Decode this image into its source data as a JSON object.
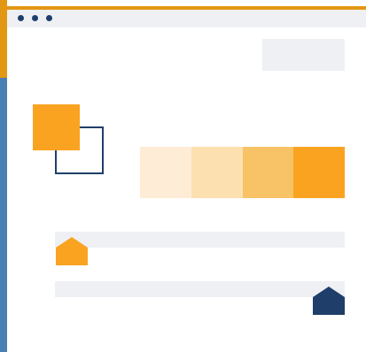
{
  "window": {
    "titlebar": {
      "controls": [
        {
          "name": "window-dot-1"
        },
        {
          "name": "window-dot-2"
        },
        {
          "name": "window-dot-3"
        }
      ]
    }
  },
  "palette": {
    "accent_orange": "#faa321",
    "border_orange": "#e29713",
    "navy": "#1f3f6a",
    "left_blue": "#4a7fb4",
    "light_gray": "#eef0f4",
    "swatches": [
      "#ffecd7",
      "#fde0b0",
      "#f8c366",
      "#faa321"
    ]
  },
  "sliders": {
    "top": {
      "value": 0.02
    },
    "bottom": {
      "value": 0.95
    }
  }
}
